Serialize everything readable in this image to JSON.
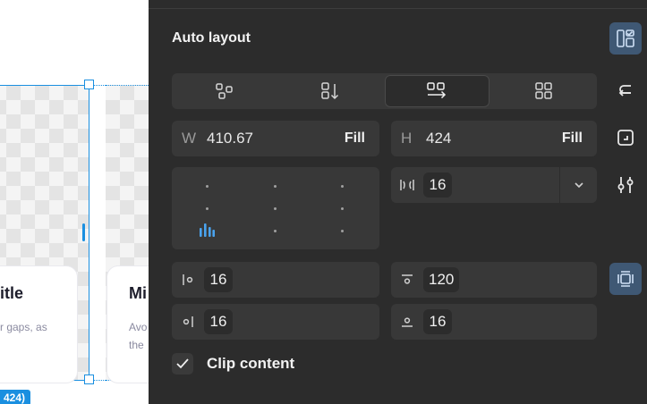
{
  "canvas": {
    "card1": {
      "title": "itle",
      "body": "r gaps, as"
    },
    "card2": {
      "title": "Mi",
      "body_line1": "Avo",
      "body_line2": "the"
    },
    "size_badge": "424)"
  },
  "panel": {
    "section_title": "Auto layout",
    "direction_options": [
      "freeform-icon",
      "vertical-icon",
      "horizontal-wrap-icon",
      "grid-icon"
    ],
    "active_direction": "horizontal-wrap",
    "width": {
      "label": "W",
      "value": "410.67",
      "mode": "Fill"
    },
    "height": {
      "label": "H",
      "value": "424",
      "mode": "Fill"
    },
    "gap": {
      "value": "16"
    },
    "padding": {
      "left": "16",
      "top": "120",
      "right": "16",
      "bottom": "16"
    },
    "clip_content": {
      "label": "Clip content",
      "checked": true
    },
    "colors": {
      "accent": "#1a8fe0",
      "panel_bg": "#2c2c2c",
      "field_bg": "#383838",
      "active_btn": "#3f5874"
    }
  }
}
